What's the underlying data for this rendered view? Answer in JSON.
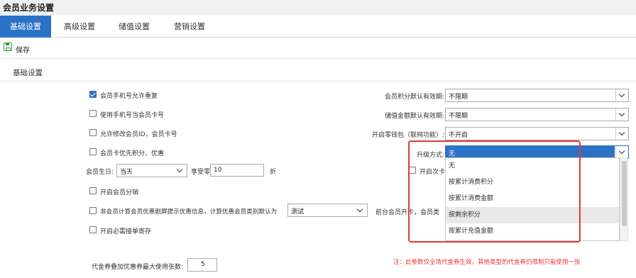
{
  "window": {
    "title": "会员业务设置"
  },
  "tabs": [
    {
      "label": "基础设置",
      "active": true
    },
    {
      "label": "高级设置",
      "active": false
    },
    {
      "label": "储值设置",
      "active": false
    },
    {
      "label": "营销设置",
      "active": false
    }
  ],
  "toolbar": {
    "save_label": "保存",
    "save_icon": "save-icon"
  },
  "section": {
    "title": "基础设置"
  },
  "left_options": {
    "phone_duplicate": {
      "label": "会员手机号允许重复",
      "checked": true
    },
    "phone_as_card": {
      "label": "使用手机号当会员卡号",
      "checked": false
    },
    "allow_modify_id": {
      "label": "允许修改会员ID，会员卡号",
      "checked": false
    },
    "card_first_points": {
      "label": "会员卡优先积分、优惠",
      "checked": false
    },
    "birthday": {
      "label": "会员生日:",
      "select_value": "当天",
      "discount_label": "享受零售价的",
      "discount_value": "10",
      "discount_unit": "折"
    },
    "member_split": {
      "label": "开启会员分销",
      "checked": false
    },
    "non_member_calc": {
      "label": "非会员计算会员优惠剧屏提示优惠信息，计算优惠会员类别默认为",
      "checked": false,
      "select_value": "测试"
    },
    "force_deposit": {
      "label": "开启必需接单寄存",
      "checked": false
    }
  },
  "right_options": {
    "points_validity": {
      "label": "会员积分默认有效期:",
      "value": "不限期"
    },
    "stored_validity": {
      "label": "储值金额默认有效期:",
      "value": "不限期"
    },
    "shortage_pack": {
      "label": "开启零钱包（联网功能）:",
      "value": "不开启"
    },
    "upgrade_mode": {
      "label": "升级方式:",
      "value": "无"
    },
    "partial_open": {
      "label": "开启次卡"
    },
    "front_card_text": "前台会员开卡，会员类"
  },
  "upgrade_dropdown": {
    "options": [
      "无",
      "按累计消费积分",
      "按累计消费金额",
      "按剩余积分",
      "按累计充值金额"
    ],
    "hovered_index": 3
  },
  "coupon": {
    "label": "代金券叠加优惠券最大使用张数:",
    "value": "5"
  },
  "note": "注：此参数仅全场代金券生效，其他类型的代金券仍限制只能使用一张",
  "colors": {
    "accent": "#2b72c6",
    "highlight": "#e53935",
    "save_green": "#2e9a3a"
  }
}
